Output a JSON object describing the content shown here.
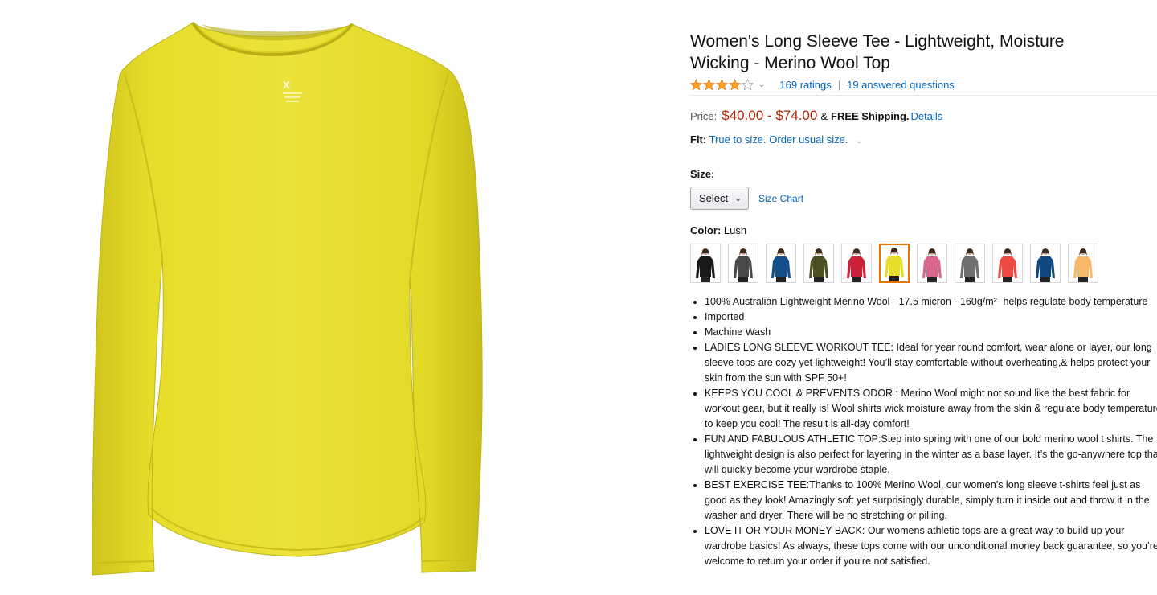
{
  "product": {
    "title_faded": "",
    "title": "Women's Long Sleeve Tee - Lightweight, Moisture Wicking - Merino Wool Top",
    "rating_value": 4,
    "ratings_link": "169 ratings",
    "questions_link": "19 answered questions",
    "price_label": "Price:",
    "price": "$40.00 - $74.00",
    "amp": "&",
    "free_shipping": "FREE Shipping.",
    "details_link": "Details",
    "fit_label": "Fit:",
    "fit_text": "True to size. Order usual size.",
    "size_label": "Size:",
    "size_select": "Select",
    "size_chart": "Size Chart",
    "color_label": "Color:",
    "color_value": "Lush",
    "main_image_color": "#e6dd2a"
  },
  "swatches": [
    {
      "name": "black",
      "color": "#1a1a1a"
    },
    {
      "name": "charcoal",
      "color": "#4a4a48"
    },
    {
      "name": "blue",
      "color": "#124f8c"
    },
    {
      "name": "olive",
      "color": "#4c4f22"
    },
    {
      "name": "red",
      "color": "#cc2239"
    },
    {
      "name": "lush",
      "color": "#e6dd2a",
      "selected": true
    },
    {
      "name": "pink",
      "color": "#d9658f"
    },
    {
      "name": "gray",
      "color": "#6f6f72"
    },
    {
      "name": "coral",
      "color": "#ee4a43"
    },
    {
      "name": "navy-blue",
      "color": "#104a80"
    },
    {
      "name": "peach",
      "color": "#f9b869"
    }
  ],
  "bullets": [
    "100% Australian Lightweight Merino Wool - 17.5 micron - 160g/m²- helps regulate body temperature",
    "Imported",
    "Machine Wash",
    "LADIES LONG SLEEVE WORKOUT TEE: Ideal for year round comfort, wear alone or layer, our long sleeve tops are cozy yet lightweight! You’ll stay comfortable without overheating,& helps protect your skin from the sun with SPF 50+!",
    "KEEPS YOU COOL & PREVENTS ODOR : Merino Wool might not sound like the best fabric for workout gear, but it really is! Wool shirts wick moisture away from the skin & regulate body temperature to keep you cool! The result is all-day comfort!",
    "FUN AND FABULOUS ATHLETIC TOP:Step into spring with one of our bold merino wool t shirts. The lightweight design is also perfect for layering in the winter as a base layer. It’s the go-anywhere top that will quickly become your wardrobe staple.",
    "BEST EXERCISE TEE:Thanks to 100% Merino Wool, our women’s long sleeve t-shirts feel just as good as they look! Amazingly soft yet surprisingly durable, simply turn it inside out and throw it in the washer and dryer. There will be no stretching or pilling.",
    "LOVE IT OR YOUR MONEY BACK: Our womens athletic tops are a great way to build up your wardrobe basics! As always, these tops come with our unconditional money back guarantee, so you’re welcome to return your order if you’re not satisfied."
  ],
  "icons": {
    "star": "star-icon",
    "chevron": "chevron-down-icon"
  }
}
